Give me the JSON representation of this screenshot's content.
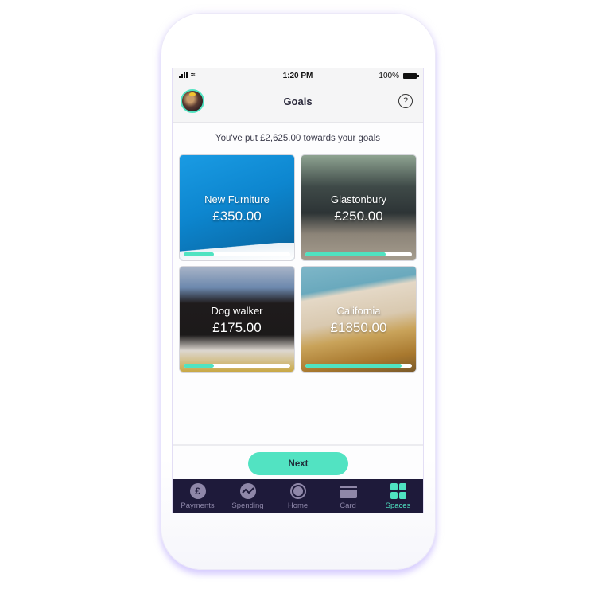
{
  "status_bar": {
    "time": "1:20 PM",
    "battery": "100%"
  },
  "header": {
    "title": "Goals",
    "help_icon": "question-circle-icon",
    "avatar": "user-avatar"
  },
  "summary": "You've put £2,625.00 towards your goals",
  "goals": [
    {
      "name": "New Furniture",
      "amount": "£350.00",
      "progress": 0.28,
      "image": "blue-chair"
    },
    {
      "name": "Glastonbury",
      "amount": "£250.00",
      "progress": 0.75,
      "image": "festival-mud"
    },
    {
      "name": "Dog walker",
      "amount": "£175.00",
      "progress": 0.28,
      "image": "pug-dog"
    },
    {
      "name": "California",
      "amount": "£1850.00",
      "progress": 0.9,
      "image": "beach"
    }
  ],
  "next_button": "Next",
  "tabs": [
    {
      "label": "Payments",
      "icon": "pound-icon",
      "active": false
    },
    {
      "label": "Spending",
      "icon": "spending-chart-icon",
      "active": false
    },
    {
      "label": "Home",
      "icon": "home-circle-icon",
      "active": false
    },
    {
      "label": "Card",
      "icon": "card-icon",
      "active": false
    },
    {
      "label": "Spaces",
      "icon": "spaces-grid-icon",
      "active": true
    }
  ],
  "colors": {
    "accent": "#4fe3c1",
    "tabbar": "#1e1a3a",
    "tab_inactive": "#8d86a8"
  }
}
